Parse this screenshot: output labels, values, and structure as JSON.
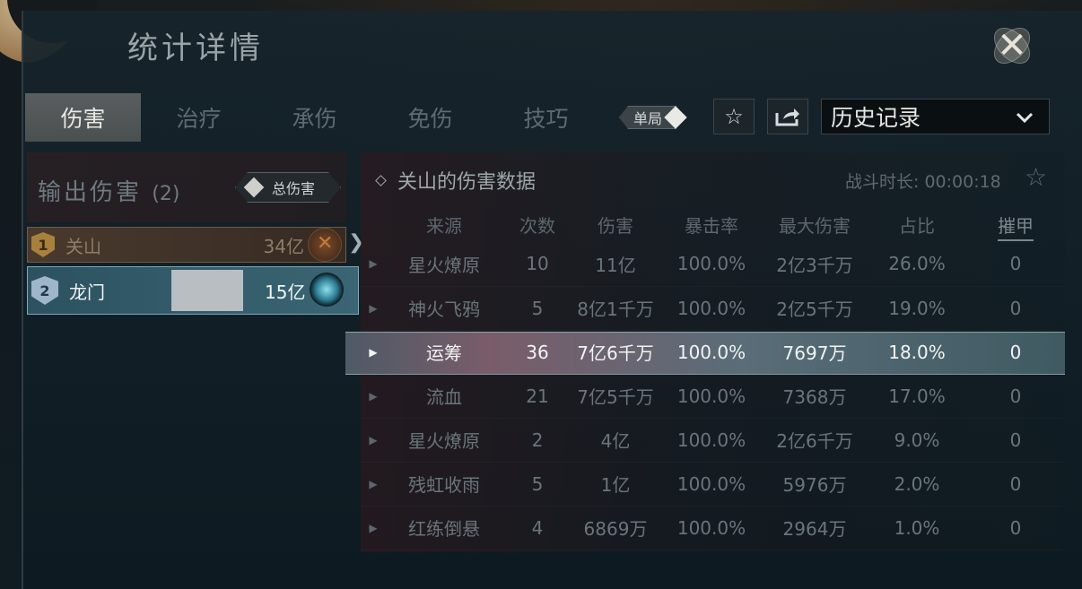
{
  "window": {
    "title": "统计详情"
  },
  "tabs": [
    "伤害",
    "治疗",
    "承伤",
    "免伤",
    "技巧"
  ],
  "active_tab": 0,
  "toolbar": {
    "mode_label": "单局",
    "history_label": "历史记录"
  },
  "left_panel": {
    "header_label": "输出伤害",
    "header_count": "(2)",
    "total_button_label": "总伤害",
    "players": [
      {
        "rank": "1",
        "name": "关山",
        "damage": "34亿"
      },
      {
        "rank": "2",
        "name": "龙门",
        "damage": "15亿"
      }
    ]
  },
  "detail": {
    "title": "关山的伤害数据",
    "duration": "战斗时长: 00:00:18",
    "columns": [
      "来源",
      "次数",
      "伤害",
      "暴击率",
      "最大伤害",
      "占比",
      "摧甲"
    ],
    "rows": [
      {
        "source": "星火燎原",
        "count": "10",
        "damage": "11亿",
        "crit": "100.0%",
        "max": "2亿3千万",
        "pct": "26.0%",
        "armor": "0"
      },
      {
        "source": "神火飞鸦",
        "count": "5",
        "damage": "8亿1千万",
        "crit": "100.0%",
        "max": "2亿5千万",
        "pct": "19.0%",
        "armor": "0"
      },
      {
        "source": "运筹",
        "count": "36",
        "damage": "7亿6千万",
        "crit": "100.0%",
        "max": "7697万",
        "pct": "18.0%",
        "armor": "0"
      },
      {
        "source": "流血",
        "count": "21",
        "damage": "7亿5千万",
        "crit": "100.0%",
        "max": "7368万",
        "pct": "17.0%",
        "armor": "0"
      },
      {
        "source": "星火燎原",
        "count": "2",
        "damage": "4亿",
        "crit": "100.0%",
        "max": "2亿6千万",
        "pct": "9.0%",
        "armor": "0"
      },
      {
        "source": "残虹收雨",
        "count": "5",
        "damage": "1亿",
        "crit": "100.0%",
        "max": "5976万",
        "pct": "2.0%",
        "armor": "0"
      },
      {
        "source": "红练倒悬",
        "count": "4",
        "damage": "6869万",
        "crit": "100.0%",
        "max": "2964万",
        "pct": "1.0%",
        "armor": "0"
      }
    ],
    "highlighted_row": 2
  },
  "icons": {
    "close": "close-icon",
    "favorite": "star-icon",
    "share": "share-icon",
    "dropdown": "chevron-down-icon"
  }
}
